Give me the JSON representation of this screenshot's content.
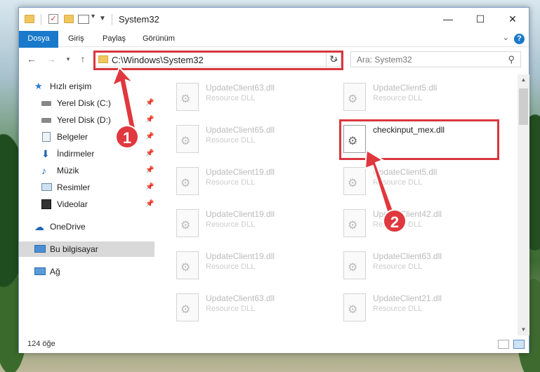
{
  "window": {
    "title": "System32",
    "minimize": "—",
    "maximize": "☐",
    "close": "✕"
  },
  "ribbon": {
    "tabs": [
      "Dosya",
      "Giriş",
      "Paylaş",
      "Görünüm"
    ],
    "help": "?"
  },
  "nav": {
    "address": "C:\\Windows\\System32",
    "search_placeholder": "Ara: System32"
  },
  "sidebar": {
    "items": [
      {
        "label": "Hızlı erişim",
        "icon": "star-icon"
      },
      {
        "label": "Yerel Disk (C:)",
        "icon": "drive-icon",
        "pinned": true
      },
      {
        "label": "Yerel Disk (D:)",
        "icon": "drive-icon",
        "pinned": true
      },
      {
        "label": "Belgeler",
        "icon": "documents-icon",
        "pinned": true
      },
      {
        "label": "İndirmeler",
        "icon": "download-icon",
        "pinned": true
      },
      {
        "label": "Müzik",
        "icon": "music-icon",
        "pinned": true
      },
      {
        "label": "Resimler",
        "icon": "pictures-icon",
        "pinned": true
      },
      {
        "label": "Videolar",
        "icon": "videos-icon",
        "pinned": true
      },
      {
        "label": "OneDrive",
        "icon": "cloud-icon"
      },
      {
        "label": "Bu bilgisayar",
        "icon": "computer-icon",
        "selected": true
      },
      {
        "label": "Ağ",
        "icon": "network-icon"
      }
    ]
  },
  "files": [
    {
      "name": "UpdateClient63.dll",
      "type": "Resource DLL"
    },
    {
      "name": "UpdateClient5.dll",
      "type": "Resource DLL"
    },
    {
      "name": "UpdateClient65.dll",
      "type": "Resource DLL"
    },
    {
      "name": "checkinput_mex.dll",
      "type": ""
    },
    {
      "name": "UpdateClient19.dll",
      "type": "Resource DLL"
    },
    {
      "name": "UpdateClient5.dll",
      "type": "Resource DLL"
    },
    {
      "name": "UpdateClient19.dll",
      "type": "Resource DLL"
    },
    {
      "name": "UpdateClient42.dll",
      "type": "Resource DLL"
    },
    {
      "name": "UpdateClient19.dll",
      "type": "Resource DLL"
    },
    {
      "name": "UpdateClient63.dll",
      "type": "Resource DLL"
    },
    {
      "name": "UpdateClient63.dll",
      "type": "Resource DLL"
    },
    {
      "name": "UpdateClient21.dll",
      "type": "Resource DLL"
    }
  ],
  "status": {
    "count": "124 öğe"
  },
  "callouts": [
    "1",
    "2"
  ],
  "colors": {
    "accent": "#1979ca",
    "highlight": "#d9363e"
  }
}
